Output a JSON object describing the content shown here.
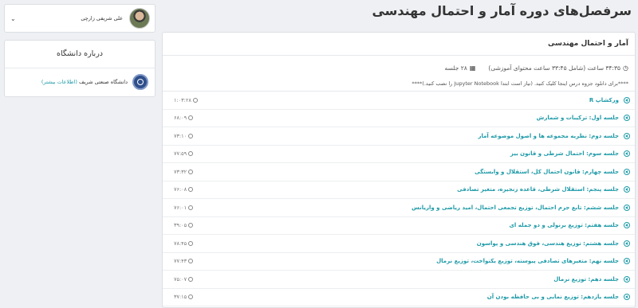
{
  "page": {
    "title": "سرفصل‌های دوره آمار و احتمال مهندسی"
  },
  "course": {
    "name": "آمار و احتمال مهندسی",
    "duration_text": "۳۴:۳۵ ساعت (شامل ۳۳:۴۵ ساعت محتوای آموزشی)",
    "sessions_text": "۲۸ جلسه",
    "notice": "****برای دانلود جزوه درس اینجا کلیک کنید. (نیاز است ابتدا Jupyter Notebook را نصب کنید.)****"
  },
  "lessons": [
    {
      "title": "ورکشاپ R",
      "time": "۱:۰۳:۲۸"
    },
    {
      "title": "جلسه اول: ترکیبات و شمارش",
      "time": "۶۸:۰۹"
    },
    {
      "title": "جلسه دوم: نظریه مجموعه ها و اصول موضوعه آمار",
      "time": "۷۳:۱۰"
    },
    {
      "title": "جلسه سوم: احتمال شرطی و قانون بیز",
      "time": "۷۷:۵۹"
    },
    {
      "title": "جلسه چهارم: قانون احتمال کل، استقلال و وابستگی",
      "time": "۷۳:۳۲"
    },
    {
      "title": "جلسه پنجم: استقلال شرطی، قاعده زنجیره، متغیر تصادفی",
      "time": "۷۶:۰۸"
    },
    {
      "title": "جلسه ششم: تابع جرم احتمال، توزیع تجمعی احتمال، امید ریاضی و واریانس",
      "time": "۷۶:۰۱"
    },
    {
      "title": "جلسه هفتم: توزیع برنولی و دو جمله ای",
      "time": "۳۹:۰۵"
    },
    {
      "title": "جلسه هشتم: توزیع هندسی، فوق هندسی و پواسون",
      "time": "۷۸:۴۵"
    },
    {
      "title": "جلسه نهم: متغیرهای تصادفی پیوسته، توزیع یکنواخت، توزیع نرمال",
      "time": "۷۷:۴۳"
    },
    {
      "title": "جلسه دهم: توزیع نرمال",
      "time": "۷۵:۰۷"
    },
    {
      "title": "جلسه یازدهم: توزیع نمایی و بی حافظه بودن آن",
      "time": "۳۷:۱۵"
    }
  ],
  "profile": {
    "name": "علی شریفی زارچی"
  },
  "university": {
    "heading": "درباره دانشگاه",
    "name": "دانشگاه صنعتی شریف",
    "more_link": "(اطلاعات بیشتر)"
  },
  "icons": {
    "play": "play-circle-icon",
    "clock": "clock-icon",
    "chevron": "chevron-down-icon",
    "sessions": "presentation-icon"
  },
  "colors": {
    "accent": "#1e9aa8",
    "background": "#eef0f3"
  }
}
